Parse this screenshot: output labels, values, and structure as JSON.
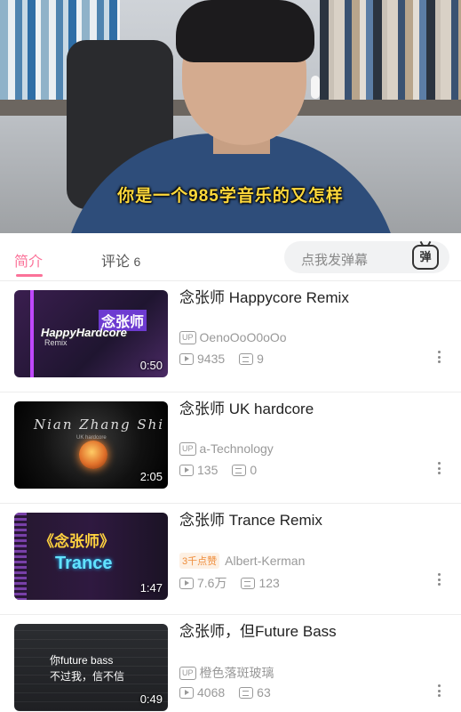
{
  "player": {
    "subtitle": "你是一个985学音乐的又怎样"
  },
  "tabs": {
    "intro": "简介",
    "comments": "评论",
    "comments_count": "6",
    "danmaku_placeholder": "点我发弹幕",
    "danmaku_icon_label": "弹"
  },
  "videos": [
    {
      "title": "念张师 Happycore Remix",
      "thumb_text": "HappyHardcore",
      "thumb_cn": "念张师",
      "thumb_sub": "Remix",
      "duration": "0:50",
      "author": "OenoOoO0oOo",
      "views": "9435",
      "danmaku": "9"
    },
    {
      "title": "念张师 UK hardcore",
      "thumb_text": "Nian Zhang Shi",
      "thumb_sub": "UK hardcore",
      "duration": "2:05",
      "author": "a-Technology",
      "views": "135",
      "danmaku": "0"
    },
    {
      "title": "念张师 Trance Remix",
      "thumb_cn": "《念张师》",
      "thumb_text": "Trance",
      "duration": "1:47",
      "hot_tag": "3千点赞",
      "author": "Albert-Kerman",
      "views": "7.6万",
      "danmaku": "123"
    },
    {
      "title": "念张师，但Future Bass",
      "thumb_line1": "你future bass",
      "thumb_line2": "不过我，信不信",
      "duration": "0:49",
      "author": "橙色落斑玻璃",
      "views": "4068",
      "danmaku": "63"
    }
  ],
  "up_tag": "UP",
  "colors": {
    "accent": "#fb7299",
    "subtitle": "#ffd93b",
    "meta": "#999999"
  }
}
